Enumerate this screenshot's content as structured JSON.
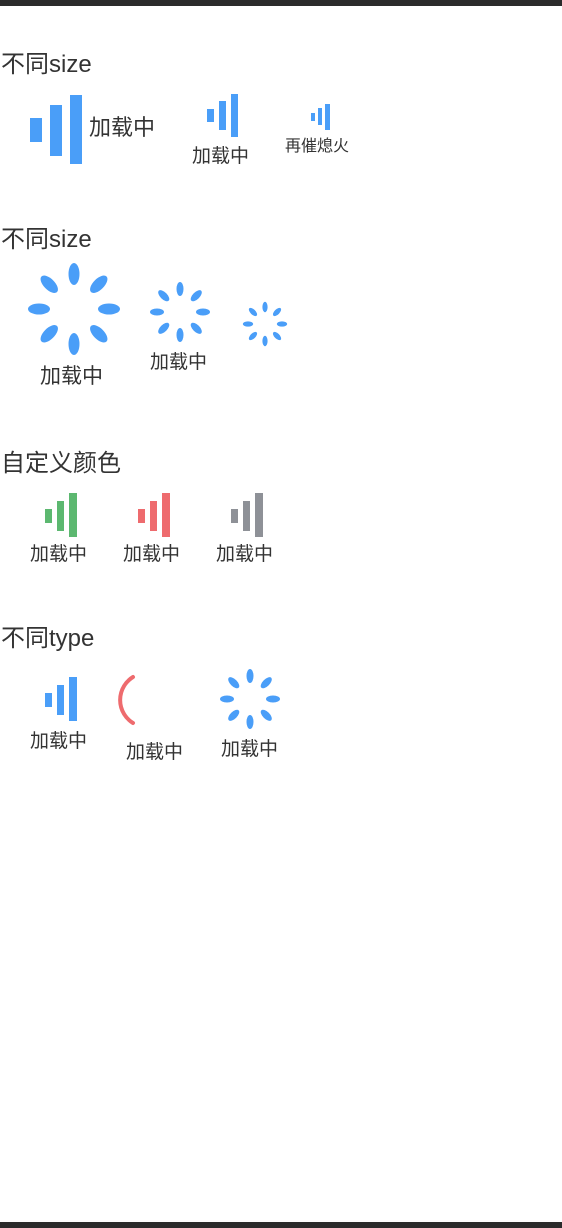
{
  "colors": {
    "blue": "#4a9ef8",
    "green": "#5cb870",
    "red": "#ee6b6e",
    "gray": "#8e9197",
    "text": "#333333"
  },
  "sections": {
    "size_bars": {
      "title": "不同size",
      "items": [
        {
          "label": "加载中",
          "size": "large",
          "icon": "loading-bars-icon"
        },
        {
          "label": "加载中",
          "size": "medium",
          "icon": "loading-bars-icon"
        },
        {
          "label": "再催熄火",
          "size": "small",
          "icon": "loading-bars-icon"
        }
      ]
    },
    "size_spinner": {
      "title": "不同size",
      "items": [
        {
          "label": "加载中",
          "size": "large",
          "icon": "loading-spinner-icon"
        },
        {
          "label": "加载中",
          "size": "medium",
          "icon": "loading-spinner-icon"
        },
        {
          "label": "",
          "size": "small",
          "icon": "loading-spinner-icon"
        }
      ]
    },
    "custom_color": {
      "title": "自定义颜色",
      "items": [
        {
          "label": "加载中",
          "color": "green",
          "icon": "loading-bars-icon"
        },
        {
          "label": "加载中",
          "color": "red",
          "icon": "loading-bars-icon"
        },
        {
          "label": "加载中",
          "color": "gray",
          "icon": "loading-bars-icon"
        }
      ]
    },
    "type": {
      "title": "不同type",
      "items": [
        {
          "label": "加载中",
          "type": "bars",
          "icon": "loading-bars-icon"
        },
        {
          "label": "加载中",
          "type": "circle",
          "icon": "loading-arc-icon"
        },
        {
          "label": "加载中",
          "type": "spinner",
          "icon": "loading-spinner-icon"
        }
      ]
    }
  }
}
